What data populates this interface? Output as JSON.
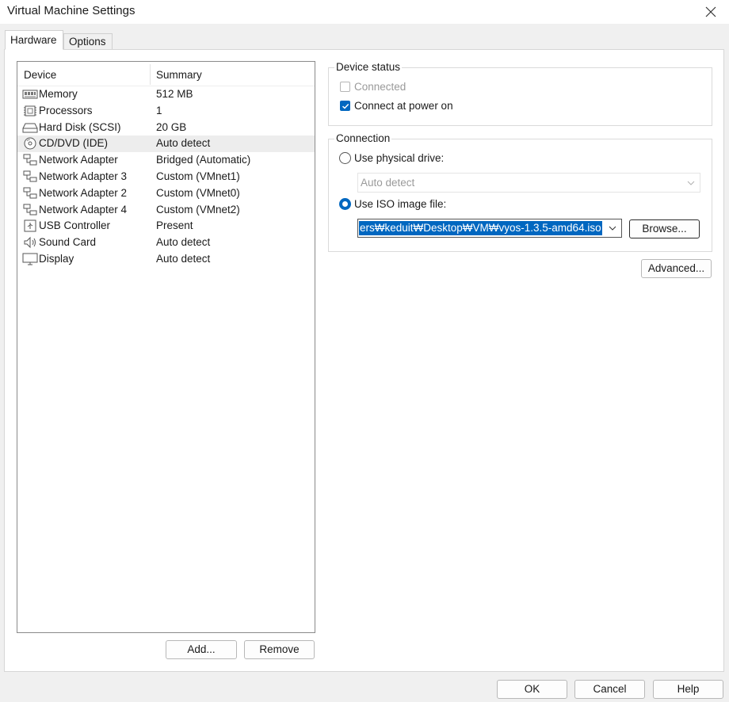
{
  "window": {
    "title": "Virtual Machine Settings"
  },
  "tabs": [
    {
      "label": "Hardware"
    },
    {
      "label": "Options"
    }
  ],
  "device_list": {
    "columns": {
      "device": "Device",
      "summary": "Summary"
    },
    "rows": [
      {
        "name": "Memory",
        "summary": "512 MB",
        "icon": "memory-icon"
      },
      {
        "name": "Processors",
        "summary": "1",
        "icon": "processor-icon"
      },
      {
        "name": "Hard Disk (SCSI)",
        "summary": "20 GB",
        "icon": "hard-disk-icon"
      },
      {
        "name": "CD/DVD (IDE)",
        "summary": "Auto detect",
        "icon": "cd-dvd-icon",
        "selected": true
      },
      {
        "name": "Network Adapter",
        "summary": "Bridged (Automatic)",
        "icon": "network-adapter-icon"
      },
      {
        "name": "Network Adapter 3",
        "summary": "Custom (VMnet1)",
        "icon": "network-adapter-icon"
      },
      {
        "name": "Network Adapter 2",
        "summary": "Custom (VMnet0)",
        "icon": "network-adapter-icon"
      },
      {
        "name": "Network Adapter 4",
        "summary": "Custom (VMnet2)",
        "icon": "network-adapter-icon"
      },
      {
        "name": "USB Controller",
        "summary": "Present",
        "icon": "usb-controller-icon"
      },
      {
        "name": "Sound Card",
        "summary": "Auto detect",
        "icon": "sound-card-icon"
      },
      {
        "name": "Display",
        "summary": "Auto detect",
        "icon": "display-icon"
      }
    ],
    "add_label": "Add...",
    "remove_label": "Remove"
  },
  "device_status": {
    "title": "Device status",
    "connected_label": "Connected",
    "connected_checked": false,
    "connected_enabled": false,
    "power_on_label": "Connect at power on",
    "power_on_checked": true
  },
  "connection": {
    "title": "Connection",
    "physical_label": "Use physical drive:",
    "physical_value": "Auto detect",
    "iso_label": "Use ISO image file:",
    "iso_value": "ers₩keduit₩Desktop₩VM₩vyos-1.3.5-amd64.iso",
    "browse_label": "Browse...",
    "selected": "iso"
  },
  "advanced_label": "Advanced...",
  "footer": {
    "ok_label": "OK",
    "cancel_label": "Cancel",
    "help_label": "Help"
  },
  "colors": {
    "accent": "#0067c0",
    "background": "#f0f0f0"
  }
}
